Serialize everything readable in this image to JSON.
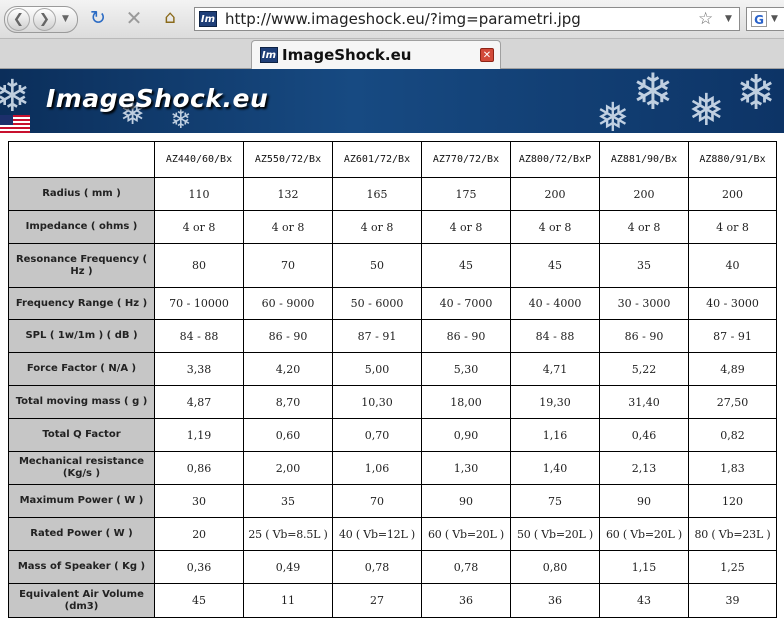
{
  "browser": {
    "url": "http://www.imageshock.eu/?img=parametri.jpg",
    "tab_title": "ImageShock.eu",
    "favicon_text": "Im",
    "search_engine_letter": "G"
  },
  "banner": {
    "logo_text": "ImageShock.eu"
  },
  "table": {
    "columns": [
      "AZ440/60/Bx",
      "AZ550/72/Bx",
      "AZ601/72/Bx",
      "AZ770/72/Bx",
      "AZ800/72/BxP",
      "AZ881/90/Bx",
      "AZ880/91/Bx"
    ],
    "rows": [
      {
        "label": "Radius ( mm )",
        "values": [
          "110",
          "132",
          "165",
          "175",
          "200",
          "200",
          "200"
        ]
      },
      {
        "label": "Impedance ( ohms )",
        "values": [
          "4 or 8",
          "4 or 8",
          "4 or 8",
          "4 or 8",
          "4 or 8",
          "4 or 8",
          "4 or 8"
        ]
      },
      {
        "label": "Resonance Frequency ( Hz )",
        "values": [
          "80",
          "70",
          "50",
          "45",
          "45",
          "35",
          "40"
        ]
      },
      {
        "label": "Frequency Range ( Hz )",
        "values": [
          "70 - 10000",
          "60 - 9000",
          "50 - 6000",
          "40 - 7000",
          "40 - 4000",
          "30 - 3000",
          "40 - 3000"
        ]
      },
      {
        "label": "SPL ( 1w/1m ) ( dB )",
        "values": [
          "84 - 88",
          "86 - 90",
          "87 - 91",
          "86 - 90",
          "84 - 88",
          "86 - 90",
          "87 - 91"
        ]
      },
      {
        "label": "Force Factor ( N/A )",
        "values": [
          "3,38",
          "4,20",
          "5,00",
          "5,30",
          "4,71",
          "5,22",
          "4,89"
        ]
      },
      {
        "label": "Total moving mass ( g )",
        "values": [
          "4,87",
          "8,70",
          "10,30",
          "18,00",
          "19,30",
          "31,40",
          "27,50"
        ]
      },
      {
        "label": "Total Q Factor",
        "values": [
          "1,19",
          "0,60",
          "0,70",
          "0,90",
          "1,16",
          "0,46",
          "0,82"
        ]
      },
      {
        "label": "Mechanical resistance (Kg/s )",
        "values": [
          "0,86",
          "2,00",
          "1,06",
          "1,30",
          "1,40",
          "2,13",
          "1,83"
        ]
      },
      {
        "label": "Maximum Power ( W )",
        "values": [
          "30",
          "35",
          "70",
          "90",
          "75",
          "90",
          "120"
        ]
      },
      {
        "label": "Rated Power ( W )",
        "values": [
          "20",
          "25 ( Vb=8.5L )",
          "40 ( Vb=12L )",
          "60 ( Vb=20L )",
          "50 ( Vb=20L )",
          "60 ( Vb=20L )",
          "80 ( Vb=23L )"
        ]
      },
      {
        "label": "Mass of Speaker ( Kg )",
        "values": [
          "0,36",
          "0,49",
          "0,78",
          "0,78",
          "0,80",
          "1,15",
          "1,25"
        ]
      },
      {
        "label": "Equivalent Air Volume (dm3)",
        "values": [
          "45",
          "11",
          "27",
          "36",
          "36",
          "43",
          "39"
        ]
      }
    ]
  }
}
